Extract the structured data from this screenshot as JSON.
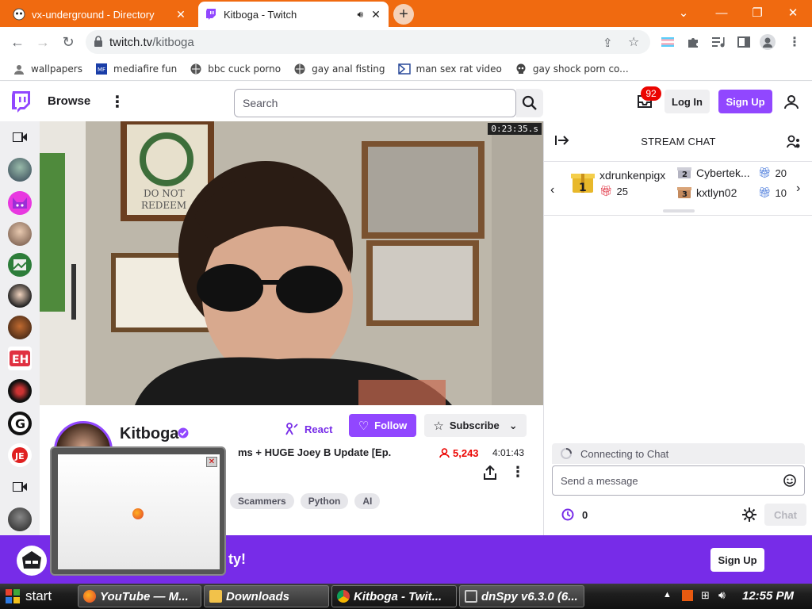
{
  "tabs": [
    {
      "title": "vx-underground - Directory",
      "close": "✕"
    },
    {
      "title": "Kitboga - Twitch",
      "close": "✕"
    }
  ],
  "address": {
    "host": "twitch.tv",
    "path": "/kitboga"
  },
  "bookmarks": [
    {
      "label": "wallpapers",
      "icon": "person-icon"
    },
    {
      "label": "mediafire fun",
      "icon": "mediafire-icon"
    },
    {
      "label": "bbc cuck porno",
      "icon": "globe-icon"
    },
    {
      "label": "gay anal fisting",
      "icon": "globe-icon"
    },
    {
      "label": "man sex rat video",
      "icon": "film-icon"
    },
    {
      "label": "gay shock porn co...",
      "icon": "skull-icon"
    }
  ],
  "twitch_nav": {
    "browse": "Browse",
    "search_placeholder": "Search",
    "inbox_count": "92",
    "login": "Log In",
    "signup": "Sign Up"
  },
  "video": {
    "timestamp": "0:23:35.s"
  },
  "channel": {
    "name": "Kitboga",
    "title_fragment": "ms + HUGE Joey B Update [Ep.",
    "viewers": "5,243",
    "uptime": "4:01:43",
    "react": "React",
    "follow": "Follow",
    "subscribe": "Subscribe",
    "tags": [
      "Scammers",
      "Python",
      "AI"
    ]
  },
  "chat": {
    "header": "STREAM CHAT",
    "gifters": [
      {
        "rank": "1",
        "name": "xdrunkenpigx",
        "count": "25"
      },
      {
        "rank": "2",
        "name": "Cybertek...",
        "count": "20"
      },
      {
        "rank": "3",
        "name": "kxtlyn02",
        "count": "10"
      }
    ],
    "connecting": "Connecting to Chat",
    "input_placeholder": "Send a message",
    "points": "0",
    "chat_button": "Chat"
  },
  "banner": {
    "text_visible": "ty!",
    "signup": "Sign Up"
  },
  "taskbar": {
    "start": "start",
    "tasks": [
      "YouTube — M...",
      "Downloads",
      "Kitboga - Twit...",
      "dnSpy v6.3.0 (6..."
    ],
    "clock": "12:55 PM"
  },
  "colors": {
    "twitch_purple": "#9147ff",
    "chrome_orange": "#f06a10",
    "live_red": "#eb0400"
  }
}
